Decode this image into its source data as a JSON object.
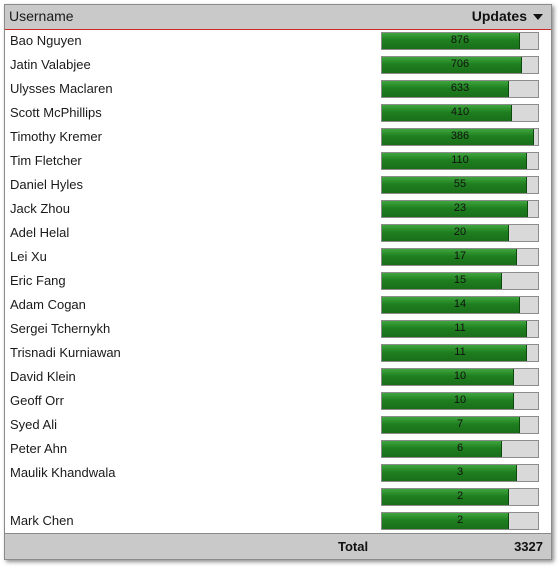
{
  "header": {
    "username_label": "Username",
    "updates_label": "Updates",
    "sort_icon": "sort-desc-icon"
  },
  "users": [
    {
      "name": "Bao Nguyen",
      "updates": "876",
      "fill": 0.88
    },
    {
      "name": "Jatin Valabjee",
      "updates": "706",
      "fill": 0.89
    },
    {
      "name": "Ulysses Maclaren",
      "updates": "633",
      "fill": 0.81
    },
    {
      "name": "Scott McPhillips",
      "updates": "410",
      "fill": 0.83
    },
    {
      "name": "Timothy Kremer",
      "updates": "386",
      "fill": 0.97
    },
    {
      "name": "Tim Fletcher",
      "updates": "110",
      "fill": 0.92
    },
    {
      "name": "Daniel Hyles",
      "updates": "55",
      "fill": 0.92
    },
    {
      "name": "Jack Zhou",
      "updates": "23",
      "fill": 0.93
    },
    {
      "name": "Adel Helal",
      "updates": "20",
      "fill": 0.81
    },
    {
      "name": "Lei Xu",
      "updates": "17",
      "fill": 0.86
    },
    {
      "name": "Eric Fang",
      "updates": "15",
      "fill": 0.76
    },
    {
      "name": "Adam Cogan",
      "updates": "14",
      "fill": 0.88
    },
    {
      "name": "Sergei Tchernykh",
      "updates": "11",
      "fill": 0.92
    },
    {
      "name": "Trisnadi Kurniawan",
      "updates": "11",
      "fill": 0.92
    },
    {
      "name": "David Klein",
      "updates": "10",
      "fill": 0.84
    },
    {
      "name": "Geoff Orr",
      "updates": "10",
      "fill": 0.84
    },
    {
      "name": "Syed Ali",
      "updates": "7",
      "fill": 0.88
    },
    {
      "name": "Peter Ahn",
      "updates": "6",
      "fill": 0.76
    },
    {
      "name": "Maulik Khandwala",
      "updates": "3",
      "fill": 0.86
    },
    {
      "name": "",
      "updates": "2",
      "fill": 0.81
    },
    {
      "name": "Mark Chen",
      "updates": "2",
      "fill": 0.81
    }
  ],
  "footer": {
    "total_label": "Total",
    "total_value": "3327"
  },
  "colors": {
    "bar_fill": "#1f7f1f",
    "bar_track": "#d9d9d9",
    "header_bg": "#c9c9c9",
    "header_rule": "#cc2a2a"
  }
}
